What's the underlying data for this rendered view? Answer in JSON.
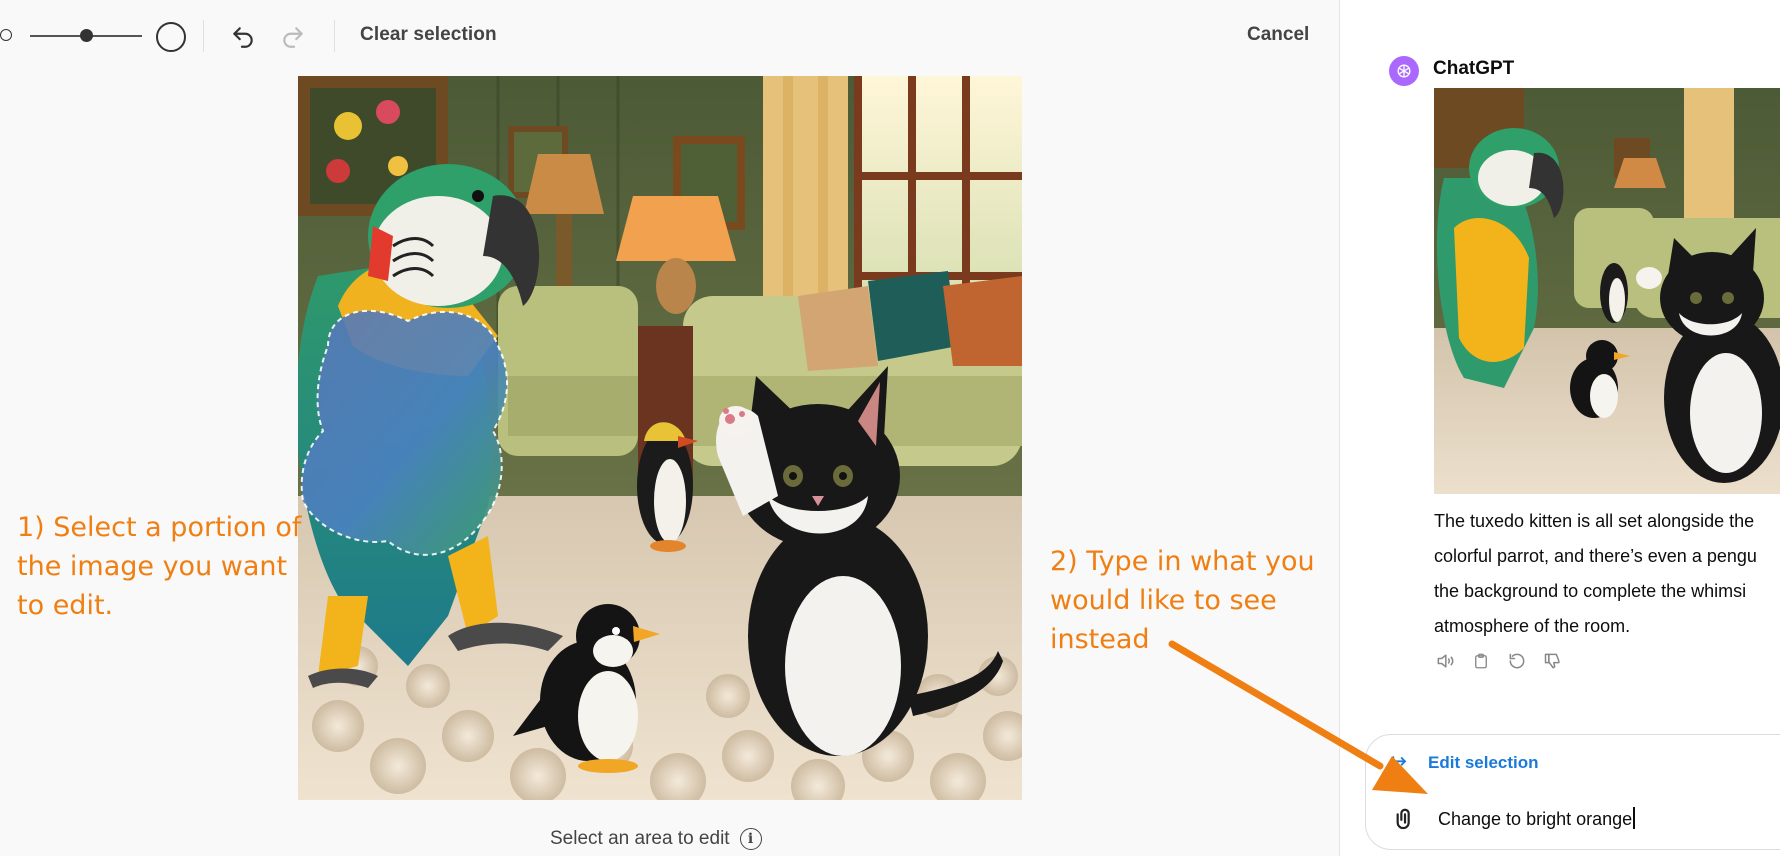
{
  "toolbar": {
    "clear_label": "Clear selection",
    "cancel_label": "Cancel",
    "brush_slider_value": 0.5
  },
  "editor": {
    "hint_text": "Select an area to edit",
    "info_glyph": "i",
    "annotation_left": {
      "lines": [
        "1) Select a portion of",
        "the image you want",
        "to edit."
      ]
    },
    "annotation_right": {
      "lines": [
        "2) Type in what you",
        "would like to see",
        "instead"
      ]
    }
  },
  "chat": {
    "assistant_name": "ChatGPT",
    "reply_lines": [
      "The tuxedo kitten is all set alongside the",
      "colorful parrot, and there’s even a pengu",
      "the background to complete the whimsi",
      "atmosphere of the room."
    ],
    "composer": {
      "edit_selection_label": "Edit selection",
      "input_value": "Change to bright orange"
    }
  },
  "colors": {
    "annotation": "#f07f13",
    "link_blue": "#1a7ad9",
    "avatar": "#ab68ff"
  },
  "icons": {
    "undo": "undo-icon",
    "redo": "redo-icon",
    "info": "info-icon",
    "attach": "paperclip-icon",
    "edit_selection": "arrow-right-icon",
    "read_aloud": "speaker-icon",
    "copy": "clipboard-icon",
    "regenerate": "refresh-icon",
    "dislike": "thumbs-down-icon"
  }
}
